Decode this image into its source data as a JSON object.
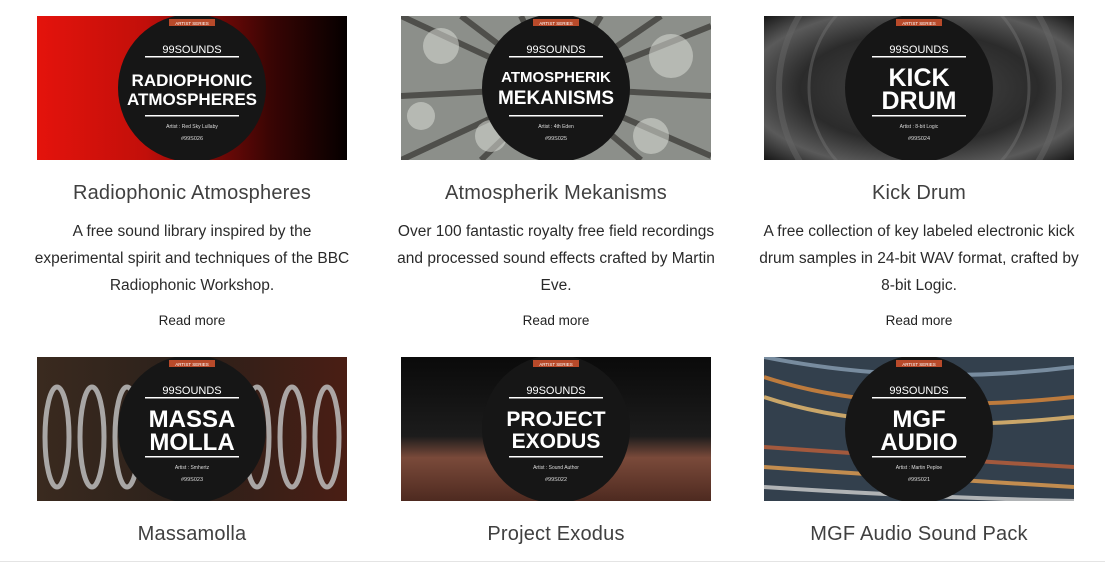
{
  "cards": [
    {
      "title": "Radiophonic Atmospheres",
      "description": "A free sound library inspired by the experimental spirit and techniques of the BBC Radiophonic Workshop.",
      "read_more": "Read more",
      "badge": {
        "series": "ARTIST SERIES",
        "brand": "99SOUNDS",
        "line1": "RADIOPHONIC",
        "line2": "ATMOSPHERES",
        "artist": "Artist : Red Sky Lullaby",
        "code": "#99S026"
      },
      "background": "red-gradient"
    },
    {
      "title": "Atmospherik Mekanisms",
      "description": "Over 100 fantastic royalty free field recordings and processed sound effects crafted by Martin Eve.",
      "read_more": "Read more",
      "badge": {
        "series": "ARTIST SERIES",
        "brand": "99SOUNDS",
        "line1": "ATMOSPHERIK",
        "line2": "MEKANISMS",
        "artist": "Artist : 4th Eden",
        "code": "#99S025"
      },
      "background": "forest-canopy"
    },
    {
      "title": "Kick Drum",
      "description": "A free collection of key labeled electronic kick drum samples in 24-bit WAV format, crafted by 8-bit Logic.",
      "read_more": "Read more",
      "badge": {
        "series": "ARTIST SERIES",
        "brand": "99SOUNDS",
        "line1": "KICK",
        "line2": "DRUM",
        "artist": "Artist : 8-bit Logic",
        "code": "#99S024"
      },
      "background": "speaker-cone"
    },
    {
      "title": "Massamolla",
      "badge": {
        "series": "ARTIST SERIES",
        "brand": "99SOUNDS",
        "line1": "MASSA",
        "line2": "MOLLA",
        "artist": "Artist : Smhertz",
        "code": "#99S023"
      },
      "background": "springs"
    },
    {
      "title": "Project Exodus",
      "badge": {
        "series": "ARTIST SERIES",
        "brand": "99SOUNDS",
        "line1": "PROJECT",
        "line2": "EXODUS",
        "artist": "Artist : Sound Author",
        "code": "#99S022"
      },
      "background": "planet-horizon"
    },
    {
      "title": "MGF Audio Sound Pack",
      "badge": {
        "series": "ARTIST SERIES",
        "brand": "99SOUNDS",
        "line1": "MGF",
        "line2": "AUDIO",
        "artist": "Artist : Martin Peploe",
        "code": "#99S021"
      },
      "background": "light-trails"
    }
  ],
  "colors": {
    "series_ribbon": "#b84a2a",
    "badge": "#161616",
    "title": "#404040"
  }
}
